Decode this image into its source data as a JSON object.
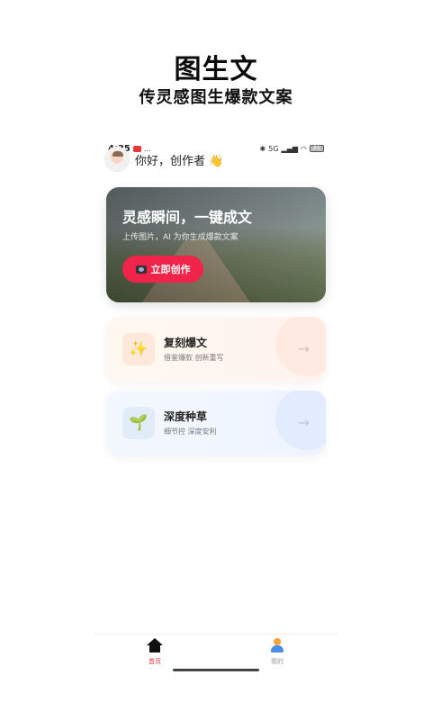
{
  "hero": {
    "title": "图生文",
    "subtitle": "传灵感图生爆款文案"
  },
  "status_bar": {
    "time": "4:35",
    "dots": "...",
    "network": "5G",
    "battery": "21"
  },
  "greeting": {
    "text": "你好，创作者 👋"
  },
  "banner": {
    "title": "灵感瞬间，一键成文",
    "subtitle": "上传图片，AI 为你生成爆款文案",
    "button_label": "立即创作"
  },
  "features": [
    {
      "title": "复刻爆文",
      "subtitle": "借鉴爆款 创新重写",
      "icon": "✨",
      "arrow": "→"
    },
    {
      "title": "深度种草",
      "subtitle": "细节控 深度安利",
      "icon": "🌱",
      "arrow": "→"
    }
  ],
  "tabbar": {
    "home_label": "首页",
    "mine_label": "我的"
  },
  "colors": {
    "accent": "#f0244a",
    "active_tab": "#e03040"
  }
}
